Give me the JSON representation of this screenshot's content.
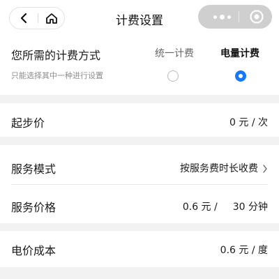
{
  "nav": {
    "title": "计费设置",
    "back_icon": "back-arrow-icon",
    "home_icon": "home-icon",
    "menu_icon": "more-dots-icon",
    "target_icon": "target-circle-icon"
  },
  "billing_method": {
    "title": "您所需的计费方式",
    "hint": "只能选择其中一种进行设置",
    "options": [
      {
        "label": "统一计费",
        "selected": false
      },
      {
        "label": "电量计费",
        "selected": true
      }
    ]
  },
  "starting_price": {
    "label": "起步价",
    "value": "0 元 / 次"
  },
  "service": {
    "mode_label": "服务模式",
    "mode_value": "按服务费时长收费",
    "price_label": "服务价格",
    "price_amount": "0.6 元 /",
    "price_duration": "30 分钟"
  },
  "electricity": {
    "label": "电价成本",
    "value": "0.6 元 / 度"
  },
  "colors": {
    "accent": "#1677ff",
    "background": "#f2f2f2",
    "capsule": "#cfcfcf"
  }
}
